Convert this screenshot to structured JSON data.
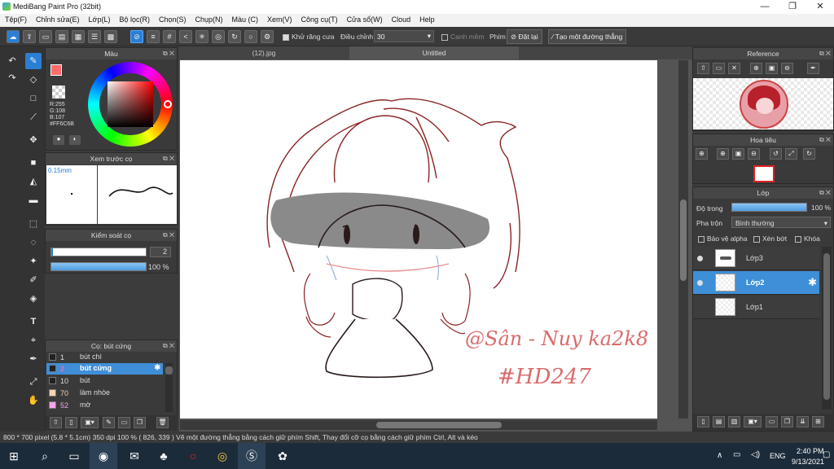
{
  "window": {
    "title": "MediBang Paint Pro (32bit)",
    "min": "—",
    "max": "❐",
    "close": "✕"
  },
  "menu": [
    "Tệp(F)",
    "Chỉnh sửa(E)",
    "Lớp(L)",
    "Bộ lọc(R)",
    "Chọn(S)",
    "Chụp(N)",
    "Màu (C)",
    "Xem(V)",
    "Công cụ(T)",
    "Cửa sổ(W)",
    "Cloud",
    "Help"
  ],
  "toolbar": {
    "antialias_label": "Khử răng cưa",
    "correction_label": "Điều chỉnh",
    "correction_value": "30",
    "smooth_label": "Canh mềm",
    "key_label": "Phím",
    "reset_label": "Đặt lại",
    "straight_line_label": "Tạo một đường thẳng"
  },
  "color_panel": {
    "title": "Màu",
    "r": "R:255",
    "g": "G:108",
    "b": "B:107",
    "hex": "#FF6C6B",
    "accent": "#ff6c6b"
  },
  "brush_preview": {
    "title": "Xem trước cọ",
    "size_label": "0.15mm"
  },
  "brush_control": {
    "title": "Kiểm soát cọ",
    "size_value": "2",
    "opacity_value": "100 %"
  },
  "brush_list": {
    "title": "Cọ: bút cứng",
    "items": [
      {
        "num": "1",
        "label": "bút chì",
        "color": "#222222"
      },
      {
        "num": "2",
        "label": "bút cứng",
        "color": "#222222"
      },
      {
        "num": "10",
        "label": "bút",
        "color": "#222222"
      },
      {
        "num": "70",
        "label": "làm nhòe",
        "color": "#f5d5b5"
      },
      {
        "num": "52",
        "label": "mờ",
        "color": "#f7a5e8"
      }
    ]
  },
  "tabs": {
    "tab1": "(12).jpg",
    "tab2": "Untitled"
  },
  "canvas": {
    "signature": "@Sân - Nuy ka2k8",
    "hashtag": "#HD247"
  },
  "reference_panel": {
    "title": "Reference"
  },
  "navigator_panel": {
    "title": "Hoa tiêu"
  },
  "layer_panel": {
    "title": "Lớp",
    "opacity_label": "Độ trong",
    "opacity_value": "100 %",
    "blend_label": "Pha trộn",
    "blend_value": "Bình thường",
    "protect_alpha": "Bảo vệ alpha",
    "clipping": "Xén bớt",
    "lock": "Khóa",
    "layers": [
      {
        "name": "Lớp3",
        "selected": false
      },
      {
        "name": "Lớp2",
        "selected": true
      },
      {
        "name": "Lớp1",
        "selected": false
      }
    ]
  },
  "status": {
    "text": "800 * 700 pixel  (5.8 * 5.1cm)  350 dpi  100 %  ( 826, 339 )  Vẽ một đường thẳng bằng cách giữ phím Shift, Thay đổi cỡ cọ bằng cách giữ phím Ctrl, Alt và kéo"
  },
  "taskbar": {
    "time": "2:40 PM",
    "date": "9/13/2021",
    "lang": "ENG"
  }
}
